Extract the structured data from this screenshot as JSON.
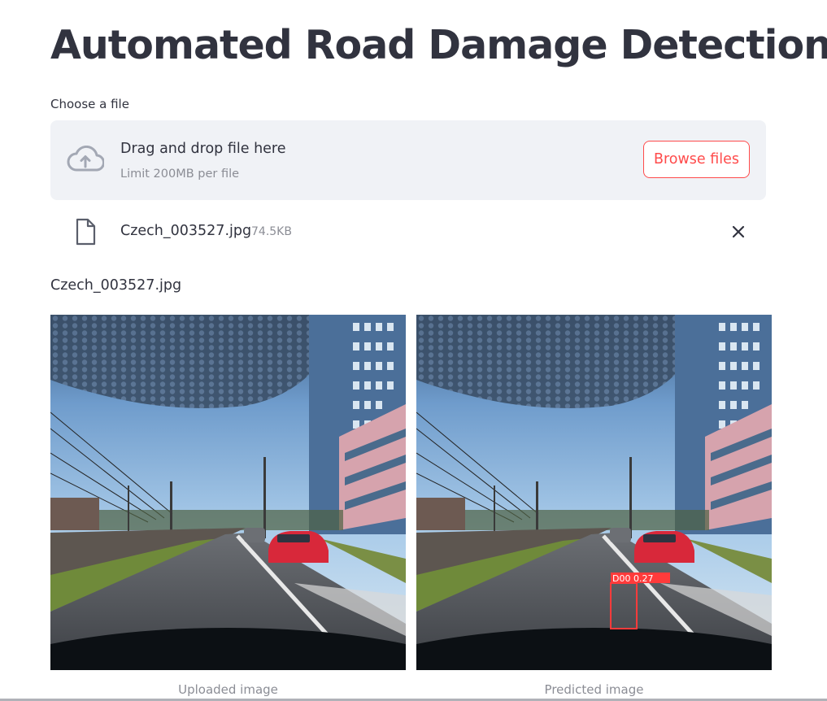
{
  "page": {
    "title": "Automated Road Damage Detection"
  },
  "uploader": {
    "label": "Choose a file",
    "drag_text": "Drag and drop file here",
    "limit_text": "Limit 200MB per file",
    "browse_label": "Browse files",
    "icon": "cloud-upload-icon"
  },
  "uploaded_file": {
    "name": "Czech_003527.jpg",
    "size": "74.5KB",
    "icon": "file-icon",
    "remove_icon": "close-icon"
  },
  "file_caption": "Czech_003527.jpg",
  "images": {
    "uploaded_caption": "Uploaded image",
    "predicted_caption": "Predicted image",
    "detection": {
      "label": "D00",
      "confidence": "0.27",
      "color": "#ff3b3b"
    }
  },
  "colors": {
    "accent": "#ff4b4b",
    "text": "#31333f",
    "muted": "#8b8d95",
    "dropzone_bg": "#f0f2f6"
  }
}
